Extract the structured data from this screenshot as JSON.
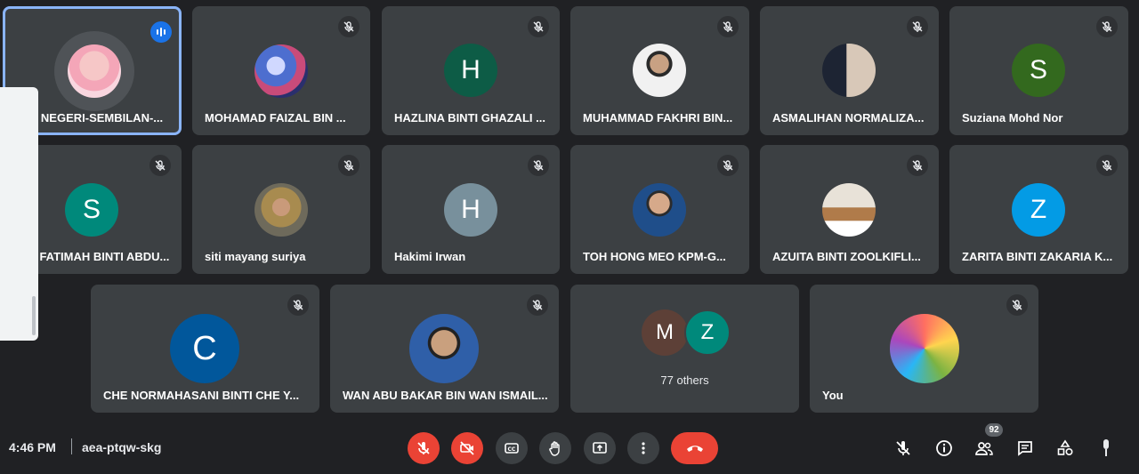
{
  "participants": [
    {
      "name": "JPN NEGERI-SEMBILAN-...",
      "avatar": "photo",
      "speaking": true
    },
    {
      "name": "MOHAMAD FAIZAL BIN ...",
      "avatar": "photo"
    },
    {
      "name": "HAZLINA BINTI GHAZALI ...",
      "avatar": "H",
      "color": "#0d5c46"
    },
    {
      "name": "MUHAMMAD FAKHRI BIN...",
      "avatar": "photo"
    },
    {
      "name": "ASMALIHAN NORMALIZA...",
      "avatar": "photo"
    },
    {
      "name": "Suziana Mohd Nor",
      "avatar": "S",
      "color": "#33691e"
    },
    {
      "name": "SITI FATIMAH BINTI ABDU...",
      "avatar": "S",
      "color": "#00897b"
    },
    {
      "name": "siti mayang suriya",
      "avatar": "photo"
    },
    {
      "name": "Hakimi Irwan",
      "avatar": "H",
      "color": "#78909c"
    },
    {
      "name": "TOH HONG MEO KPM-G...",
      "avatar": "photo"
    },
    {
      "name": "AZUITA BINTI ZOOLKIFLI...",
      "avatar": "photo"
    },
    {
      "name": "ZARITA BINTI ZAKARIA K...",
      "avatar": "Z",
      "color": "#039be5"
    },
    {
      "name": "CHE NORMAHASANI BINTI CHE Y...",
      "avatar": "C",
      "color": "#01579b"
    },
    {
      "name": "WAN ABU BAKAR BIN WAN ISMAIL...",
      "avatar": "photo"
    },
    {
      "name": "You",
      "avatar": "photo"
    }
  ],
  "others": {
    "label": "77 others",
    "avatars": [
      {
        "letter": "M",
        "color": "#5d4037"
      },
      {
        "letter": "Z",
        "color": "#00897b"
      }
    ]
  },
  "footer": {
    "time": "4:46 PM",
    "meeting_code": "aea-ptqw-skg",
    "participant_count": "92"
  },
  "controls": [
    "mic-off",
    "camera-off",
    "captions",
    "raise-hand",
    "present",
    "more-options",
    "leave-call"
  ],
  "right_controls": [
    "mute-all",
    "meeting-details",
    "people",
    "chat",
    "activities",
    "host-controls"
  ],
  "colors": {
    "background": "#202124",
    "tile": "#3c4043",
    "red": "#ea4335",
    "active_border": "#8ab4f8"
  }
}
